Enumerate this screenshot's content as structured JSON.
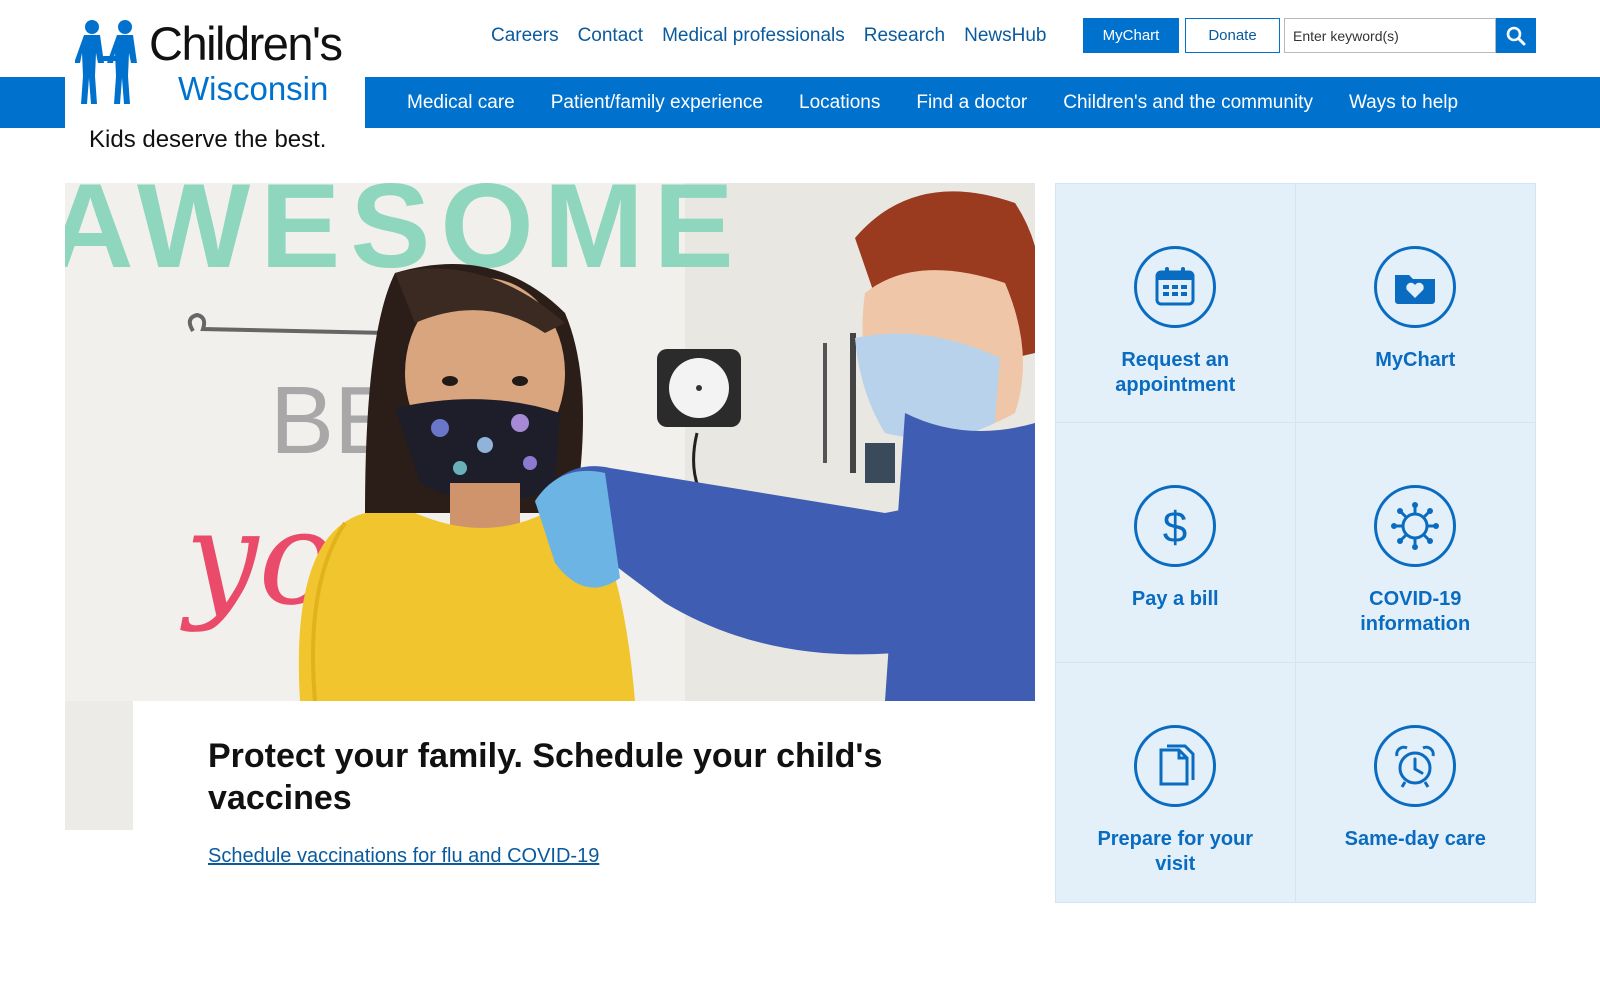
{
  "brand": {
    "logo_line1": "Children's",
    "logo_line2": "Wisconsin",
    "tagline": "Kids deserve the best.",
    "primary_color": "#0072ce",
    "link_color": "#0a5a9e",
    "tile_bg": "#e3f0fa"
  },
  "utility_nav": {
    "links": [
      "Careers",
      "Contact",
      "Medical professionals",
      "Research",
      "NewsHub"
    ],
    "mychart_label": "MyChart",
    "donate_label": "Donate",
    "search_placeholder": "Enter keyword(s)",
    "search_icon": "search-icon"
  },
  "main_nav": {
    "items": [
      "Medical care",
      "Patient/family experience",
      "Locations",
      "Find a doctor",
      "Children's and the community",
      "Ways to help"
    ]
  },
  "hero": {
    "title": "Protect your family. Schedule your child's vaccines",
    "link_text": "Schedule vaccinations for flu and COVID-19",
    "wall_word_1": "AWESOME",
    "wall_word_2": "BE",
    "wall_word_3": "you"
  },
  "tiles": [
    {
      "label": "Request an appointment",
      "icon": "calendar-icon"
    },
    {
      "label": "MyChart",
      "icon": "folder-heart-icon"
    },
    {
      "label": "Pay a bill",
      "icon": "dollar-icon"
    },
    {
      "label": "COVID-19 information",
      "icon": "virus-icon"
    },
    {
      "label": "Prepare for your visit",
      "icon": "documents-icon"
    },
    {
      "label": "Same-day care",
      "icon": "alarm-clock-icon"
    }
  ]
}
